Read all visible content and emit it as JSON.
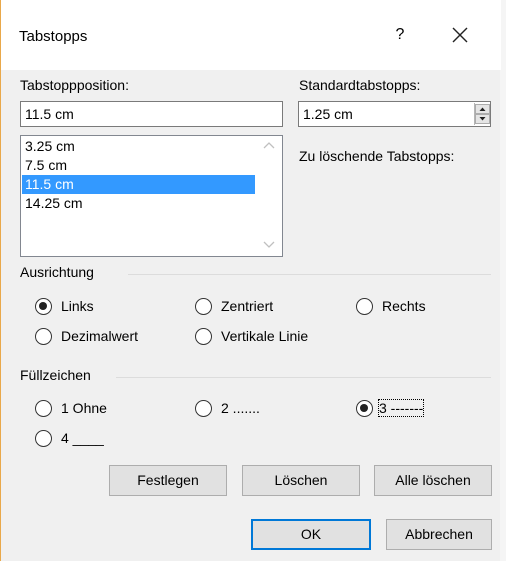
{
  "window": {
    "title": "Tabstopps",
    "help_label": "?"
  },
  "tab_position": {
    "label": "Tabstoppposition:",
    "value": "11.5 cm",
    "items": [
      "3.25 cm",
      "7.5 cm",
      "11.5 cm",
      "14.25 cm"
    ],
    "selected_index": 2
  },
  "default_tabs": {
    "label": "Standardtabstopps:",
    "value": "1.25 cm"
  },
  "to_clear": {
    "label": "Zu löschende Tabstopps:"
  },
  "alignment": {
    "title": "Ausrichtung",
    "options": [
      "Links",
      "Zentriert",
      "Rechts",
      "Dezimalwert",
      "Vertikale Linie"
    ],
    "selected": "Links"
  },
  "leader": {
    "title": "Füllzeichen",
    "options": [
      "1 Ohne",
      "2 .......",
      "3 -------",
      "4 ____"
    ],
    "selected": "3 -------"
  },
  "buttons": {
    "set": "Festlegen",
    "clear": "Löschen",
    "clear_all": "Alle löschen",
    "ok": "OK",
    "cancel": "Abbrechen"
  },
  "colors": {
    "selection": "#3399ff",
    "default_button_border": "#0078d7",
    "window_frame_accent": "#e9a84a"
  },
  "icons": {
    "close": "close-icon",
    "spin_up": "spin-up-icon",
    "spin_down": "spin-down-icon",
    "scroll_up": "scroll-up-icon",
    "scroll_down": "scroll-down-icon"
  }
}
